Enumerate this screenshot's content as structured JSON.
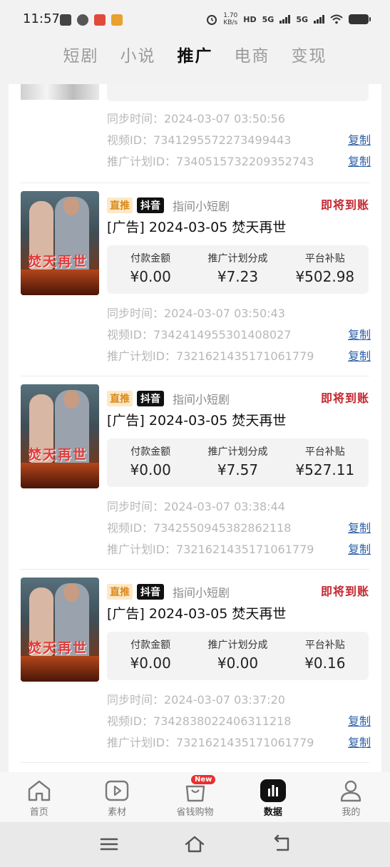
{
  "status_bar": {
    "time": "11:57",
    "net_speed_value": "1.70",
    "net_speed_unit": "KB/s",
    "hd_label": "HD",
    "net_label_1": "5G",
    "net_label_2": "5G"
  },
  "top_tabs": [
    {
      "label": "短剧",
      "active": false
    },
    {
      "label": "小说",
      "active": false
    },
    {
      "label": "推广",
      "active": true
    },
    {
      "label": "电商",
      "active": false
    },
    {
      "label": "变现",
      "active": false
    }
  ],
  "partial_item": {
    "sync_time": "同步时间：2024-03-07 03:50:56",
    "video_id": "视频ID：7341295572273499443",
    "plan_id": "推广计划ID：7340515732209352743",
    "copy_label": "复制"
  },
  "stat_labels": [
    "付款金额",
    "推广计划分成",
    "平台补贴"
  ],
  "cards": [
    {
      "tag_direct": "直推",
      "tag_platform": "抖音",
      "source": "指间小短剧",
      "status": "即将到账",
      "title": "[广告] 2024-03-05 焚天再世",
      "thumb_text": "焚天再世",
      "payment": "¥0.00",
      "plan_share": "¥7.23",
      "subsidy": "¥502.98",
      "sync_time": "同步时间：2024-03-07 03:50:43",
      "video_id": "视频ID：7342414955301408027",
      "plan_id": "推广计划ID：7321621435171061779",
      "copy_label": "复制"
    },
    {
      "tag_direct": "直推",
      "tag_platform": "抖音",
      "source": "指间小短剧",
      "status": "即将到账",
      "title": "[广告] 2024-03-05 焚天再世",
      "thumb_text": "焚天再世",
      "payment": "¥0.00",
      "plan_share": "¥7.57",
      "subsidy": "¥527.11",
      "sync_time": "同步时间：2024-03-07 03:38:44",
      "video_id": "视频ID：7342550945382862118",
      "plan_id": "推广计划ID：7321621435171061779",
      "copy_label": "复制"
    },
    {
      "tag_direct": "直推",
      "tag_platform": "抖音",
      "source": "指间小短剧",
      "status": "即将到账",
      "title": "[广告] 2024-03-05 焚天再世",
      "thumb_text": "焚天再世",
      "payment": "¥0.00",
      "plan_share": "¥0.00",
      "subsidy": "¥0.16",
      "sync_time": "同步时间：2024-03-07 03:37:20",
      "video_id": "视频ID：7342838022406311218",
      "plan_id": "推广计划ID：7321621435171061779",
      "copy_label": "复制"
    }
  ],
  "bottom_nav": [
    {
      "label": "首页",
      "icon": "home-icon",
      "active": false
    },
    {
      "label": "素材",
      "icon": "video-icon",
      "active": false
    },
    {
      "label": "省钱购物",
      "icon": "shopping-bag-icon",
      "active": false,
      "badge": "New"
    },
    {
      "label": "数据",
      "icon": "chart-icon",
      "active": true
    },
    {
      "label": "我的",
      "icon": "user-icon",
      "active": false
    }
  ],
  "colors": {
    "accent_status": "#c4262f",
    "link": "#2c5fa8",
    "tag_direct_bg": "#fde9c8",
    "tag_direct_text": "#d98a1c",
    "badge": "#e8302f"
  }
}
